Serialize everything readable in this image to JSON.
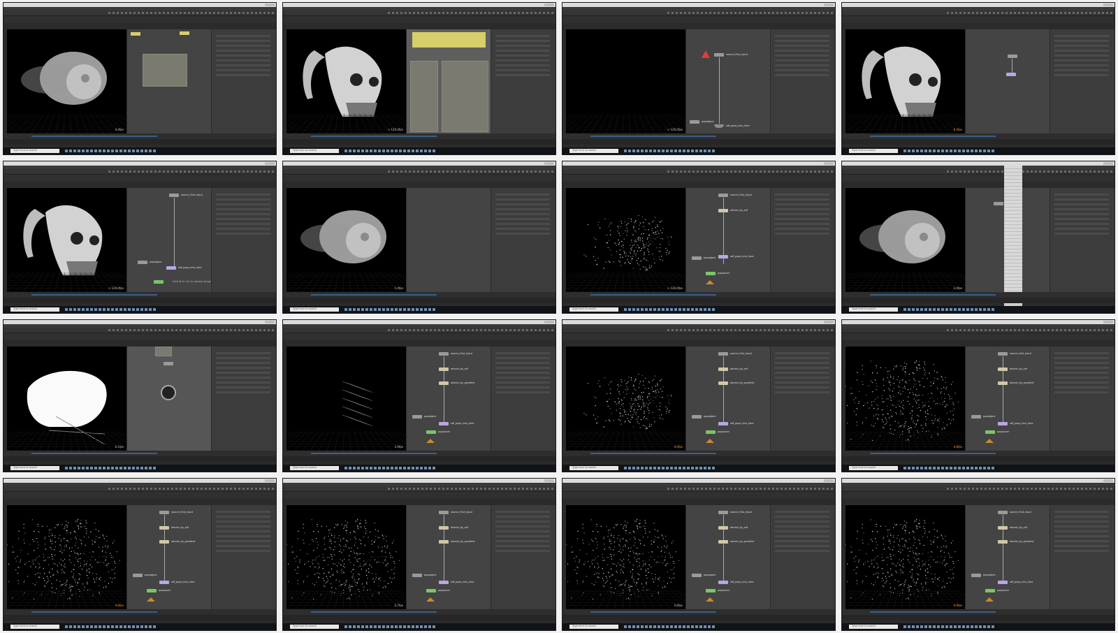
{
  "common": {
    "taskbar_search": "Type here to search"
  },
  "nodes": {
    "source": "source_first_input",
    "advect_sdf": "advect_by_sdf",
    "advect_grad": "advect_by_gradient",
    "popobject": "popobject",
    "popsolver": "popsolver",
    "output": "sdf_pops_into_here"
  },
  "thumbs": [
    {
      "fps": "4.0fps",
      "fps_color": "#d0d0d0"
    },
    {
      "fps": "> 120.0fps",
      "fps_color": "#d0d0d0"
    },
    {
      "fps": "> 120.0fps",
      "fps_color": "#d0d0d0"
    },
    {
      "fps": "6.4fps",
      "fps_color": "#e6a23c"
    },
    {
      "fps": "> 120.0fps",
      "fps_color": "#d0d0d0"
    },
    {
      "fps": "1.0fps",
      "fps_color": "#d0d0d0"
    },
    {
      "fps": "> 120.0fps",
      "fps_color": "#d0d0d0"
    },
    {
      "fps": "2.0fps",
      "fps_color": "#d0d0d0"
    },
    {
      "fps": "6.1fps",
      "fps_color": "#d0d0d0"
    },
    {
      "fps": "1.9fps",
      "fps_color": "#d0d0d0"
    },
    {
      "fps": "4.0fps",
      "fps_color": "#e6a23c"
    },
    {
      "fps": "4.8fps",
      "fps_color": "#e6a23c"
    },
    {
      "fps": "4.6fps",
      "fps_color": "#e6a23c"
    },
    {
      "fps": "2.7fps",
      "fps_color": "#d0d0d0"
    },
    {
      "fps": "3.6fps",
      "fps_color": "#d0d0d0"
    },
    {
      "fps": "4.9fps",
      "fps_color": "#e6a23c"
    }
  ],
  "hint_text": "Hold ⌘ or Ctrl to disable dropping nodes on existing wires"
}
